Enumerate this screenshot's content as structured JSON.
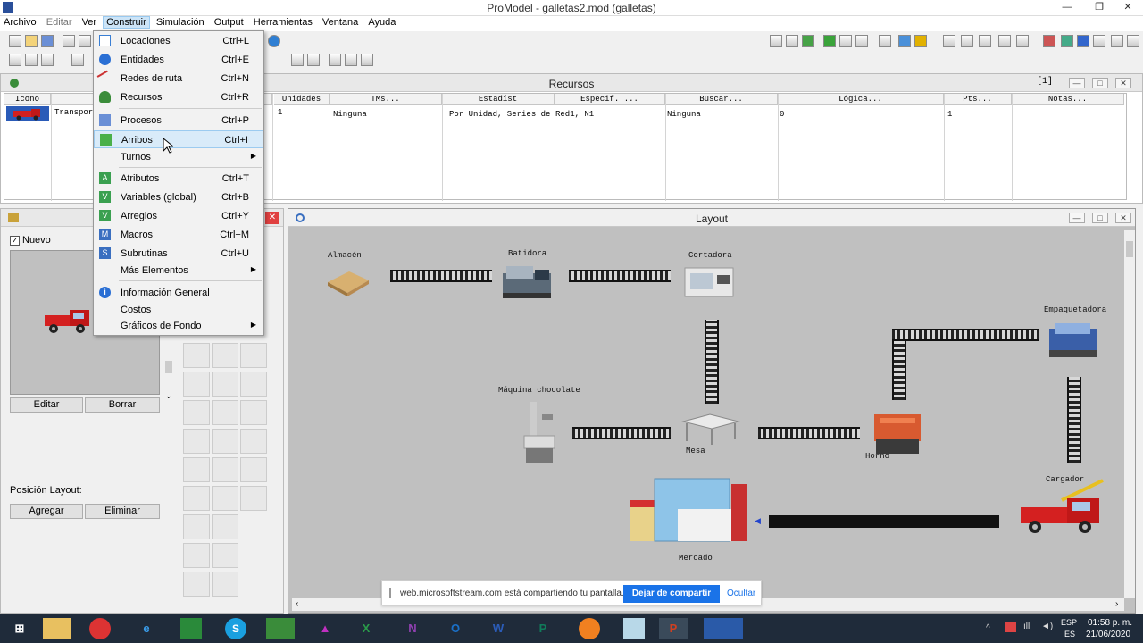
{
  "window": {
    "title": "ProModel - galletas2.mod (galletas)"
  },
  "menubar": [
    "Archivo",
    "Editar",
    "Ver",
    "Construir",
    "Simulación",
    "Output",
    "Herramientas",
    "Ventana",
    "Ayuda"
  ],
  "construir_menu": [
    {
      "label": "Locaciones",
      "shortcut": "Ctrl+L"
    },
    {
      "label": "Entidades",
      "shortcut": "Ctrl+E"
    },
    {
      "label": "Redes de ruta",
      "shortcut": "Ctrl+N"
    },
    {
      "label": "Recursos",
      "shortcut": "Ctrl+R"
    },
    {
      "label": "Procesos",
      "shortcut": "Ctrl+P"
    },
    {
      "label": "Arribos",
      "shortcut": "Ctrl+I"
    },
    {
      "label": "Turnos",
      "shortcut": ""
    },
    {
      "label": "Atributos",
      "shortcut": "Ctrl+T"
    },
    {
      "label": "Variables (global)",
      "shortcut": "Ctrl+B"
    },
    {
      "label": "Arreglos",
      "shortcut": "Ctrl+Y"
    },
    {
      "label": "Macros",
      "shortcut": "Ctrl+M"
    },
    {
      "label": "Subrutinas",
      "shortcut": "Ctrl+U"
    },
    {
      "label": "Más Elementos",
      "shortcut": ""
    },
    {
      "label": "Información General",
      "shortcut": ""
    },
    {
      "label": "Costos",
      "shortcut": ""
    },
    {
      "label": "Gráficos de Fondo",
      "shortcut": ""
    }
  ],
  "recursos": {
    "title": "Recursos",
    "page_indicator": "[1]",
    "headers": [
      "Icono",
      "",
      "Unidades",
      "TMs...",
      "Estadíst",
      "Especif. ...",
      "Buscar...",
      "Lógica...",
      "Pts...",
      "Notas..."
    ],
    "row": {
      "nombre": "Transpor",
      "unidades": "1",
      "tms": "Ninguna",
      "estadist": "Por Unidad, Series de",
      "especif": "Red1, N1",
      "buscar": "Ninguna",
      "logica": "0",
      "pts": "1"
    }
  },
  "graficos": {
    "nuevo_label": "Nuevo",
    "editar": "Editar",
    "borrar": "Borrar",
    "posicion_label": "Posición Layout:",
    "agregar": "Agregar",
    "eliminar": "Eliminar"
  },
  "layout": {
    "title": "Layout",
    "labels": {
      "almacen": "Almacén",
      "batidora": "Batidora",
      "cortadora": "Cortadora",
      "empaquetadora": "Empaquetadora",
      "maquina_chocolate": "Máquina chocolate",
      "mesa": "Mesa",
      "horno": "Horno",
      "cargador": "Cargador",
      "mercado": "Mercado"
    }
  },
  "notification": {
    "text": "web.microsoftstream.com está compartiendo tu pantalla.",
    "stop_button": "Dejar de compartir",
    "hide_button": "Ocultar"
  },
  "taskbar": {
    "lang": "ESP",
    "region": "ES",
    "time": "01:58 p. m.",
    "date": "21/06/2020"
  },
  "colors": {
    "accent": "#0078d7",
    "menu_highlight": "#d9ebf9",
    "taskbar": "#1f2b3a"
  }
}
